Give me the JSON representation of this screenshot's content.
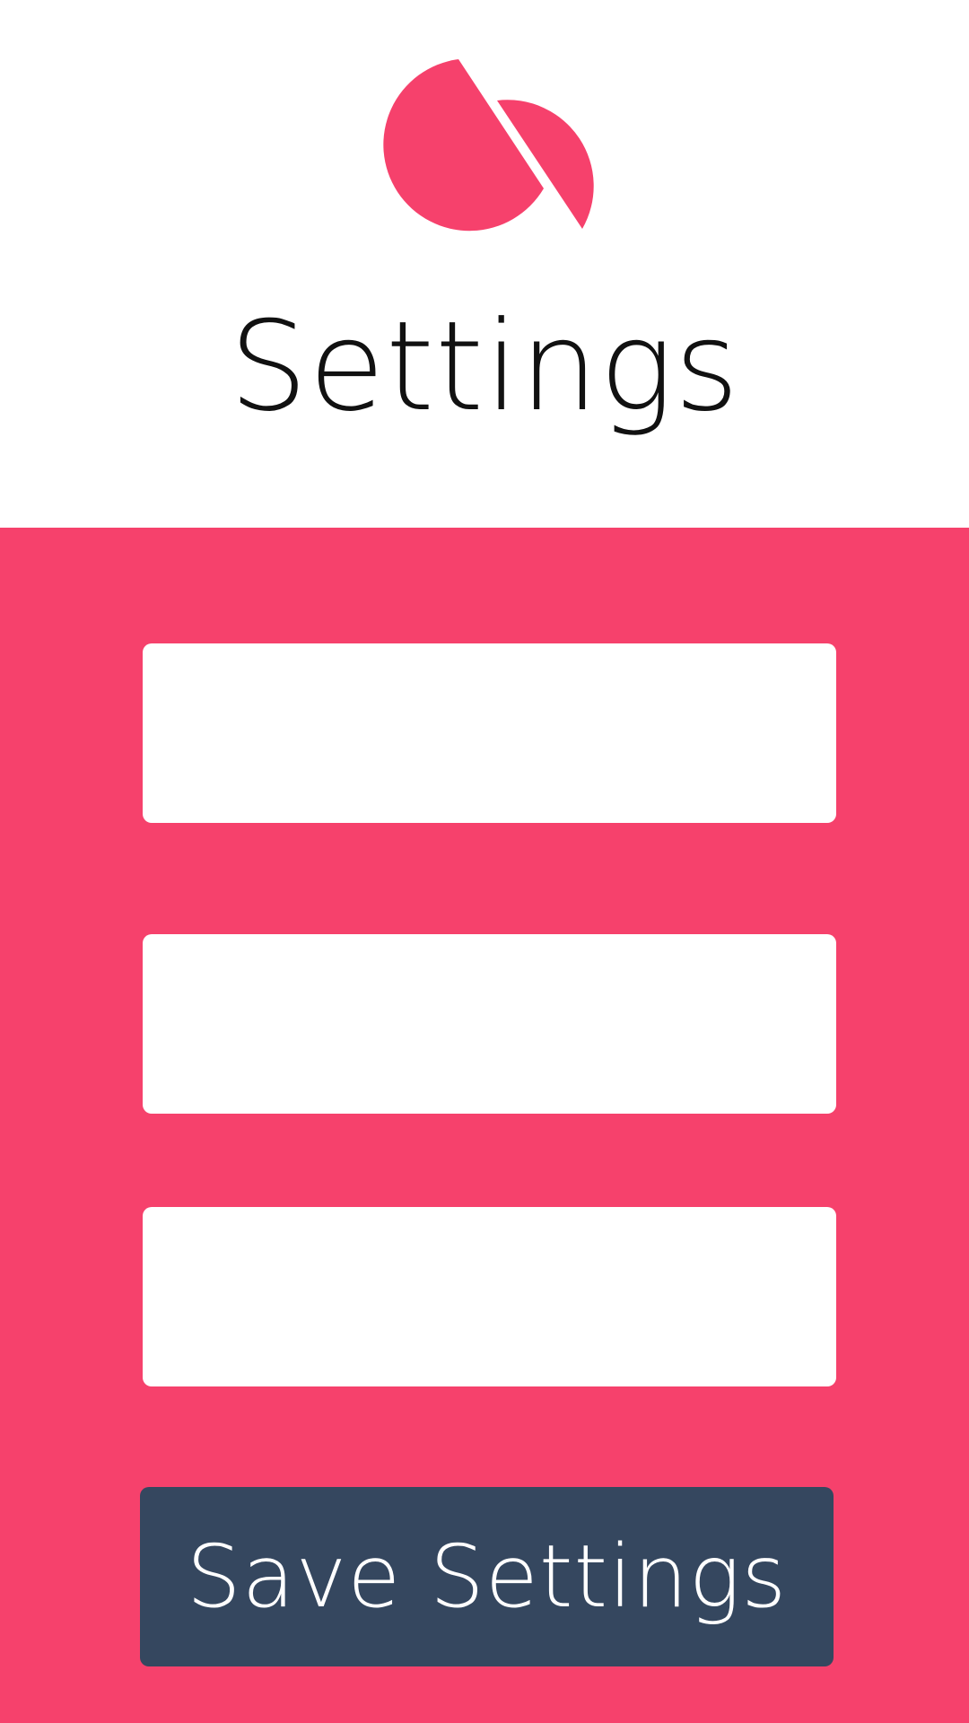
{
  "header": {
    "logo_icon": "split-circle-logo-icon",
    "title": "Settings"
  },
  "form": {
    "fields": [
      {
        "value": "",
        "placeholder": ""
      },
      {
        "value": "",
        "placeholder": ""
      },
      {
        "value": "",
        "placeholder": ""
      }
    ],
    "save_label": "Save Settings"
  },
  "colors": {
    "accent": "#f6416c",
    "button": "#35475f",
    "background": "#ffffff",
    "title_text": "#111111",
    "button_text": "#ffffff"
  }
}
